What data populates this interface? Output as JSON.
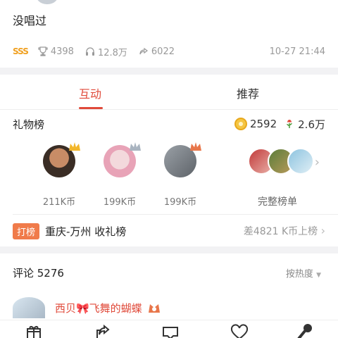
{
  "song": {
    "title": "没唱过"
  },
  "meta": {
    "level": "SSS",
    "trophies": "4398",
    "listens": "12.8万",
    "shares": "6022",
    "time": "10-27 21:44"
  },
  "tabs": [
    {
      "label": "互动",
      "active": true
    },
    {
      "label": "推荐",
      "active": false
    }
  ],
  "gifts": {
    "title": "礼物榜",
    "coins": "2592",
    "flowers": "2.6万",
    "top": [
      {
        "coins": "211K币"
      },
      {
        "coins": "199K币"
      },
      {
        "coins": "199K币"
      }
    ],
    "full_list_label": "完整榜单"
  },
  "ranking": {
    "badge": "打榜",
    "city": "重庆-万州 收礼榜",
    "diff": "差4821 K币上榜"
  },
  "comments": {
    "title": "评论 5276",
    "sort": "按热度",
    "first_user": "西贝🎀飞舞的蝴蝶"
  },
  "colors": {
    "accent": "#e04a3a",
    "badge": "#f07b4a",
    "muted": "#999999"
  },
  "bottom_bar": {
    "icons": [
      "gift-icon",
      "share-icon",
      "comment-icon",
      "heart-icon",
      "microphone-icon"
    ]
  }
}
